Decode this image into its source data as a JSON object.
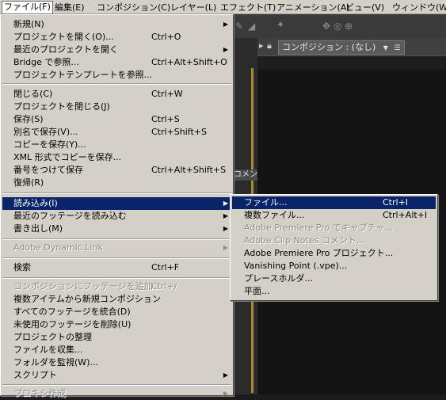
{
  "menubar": {
    "items": [
      {
        "label": "ファイル(F)"
      },
      {
        "label": "編集(E)"
      },
      {
        "label": "コンポジション(C)"
      },
      {
        "label": "レイヤー(L)"
      },
      {
        "label": "エフェクト(T)"
      },
      {
        "label": "アニメーション(A)"
      },
      {
        "label": "ビュー(V)"
      },
      {
        "label": "ウィンドウ(W)"
      }
    ]
  },
  "composition_panel": {
    "tab_label": "コンポジション : (なし)",
    "side_label": "コメン"
  },
  "file_menu": {
    "items": [
      {
        "label": "新規(N)",
        "shortcut": ""
      },
      {
        "label": "プロジェクトを開く(O)...",
        "shortcut": "Ctrl+O"
      },
      {
        "label": "最近のプロジェクトを開く",
        "shortcut": ""
      },
      {
        "label": "Bridge で参照...",
        "shortcut": "Ctrl+Alt+Shift+O"
      },
      {
        "label": "プロジェクトテンプレートを参照...",
        "shortcut": ""
      },
      {
        "label": "閉じる(C)",
        "shortcut": "Ctrl+W"
      },
      {
        "label": "プロジェクトを閉じる(J)",
        "shortcut": ""
      },
      {
        "label": "保存(S)",
        "shortcut": "Ctrl+S"
      },
      {
        "label": "別名で保存(V)...",
        "shortcut": "Ctrl+Shift+S"
      },
      {
        "label": "コピーを保存(Y)...",
        "shortcut": ""
      },
      {
        "label": "XML 形式でコピーを保存...",
        "shortcut": ""
      },
      {
        "label": "番号をつけて保存",
        "shortcut": "Ctrl+Alt+Shift+S"
      },
      {
        "label": "復帰(R)",
        "shortcut": ""
      },
      {
        "label": "読み込み(I)",
        "shortcut": ""
      },
      {
        "label": "最近のフッテージを読み込む",
        "shortcut": ""
      },
      {
        "label": "書き出し(M)",
        "shortcut": ""
      },
      {
        "label": "Adobe Dynamic Link",
        "shortcut": ""
      },
      {
        "label": "検索",
        "shortcut": "Ctrl+F"
      },
      {
        "label": "コンポジションにフッテージを追加",
        "shortcut": "Ctrl+/"
      },
      {
        "label": "複数アイテムから新規コンポジション",
        "shortcut": ""
      },
      {
        "label": "すべてのフッテージを統合(D)",
        "shortcut": ""
      },
      {
        "label": "未使用のフッテージを削除(U)",
        "shortcut": ""
      },
      {
        "label": "プロジェクトの整理",
        "shortcut": ""
      },
      {
        "label": "ファイルを収集...",
        "shortcut": ""
      },
      {
        "label": "フォルダを監視(W)...",
        "shortcut": ""
      },
      {
        "label": "スクリプト",
        "shortcut": ""
      },
      {
        "label": "プロキシ作成",
        "shortcut": ""
      }
    ]
  },
  "import_menu": {
    "items": [
      {
        "label": "ファイル...",
        "shortcut": "Ctrl+I"
      },
      {
        "label": "複数ファイル...",
        "shortcut": "Ctrl+Alt+I"
      },
      {
        "label": "Adobe Premiere Pro でキャプチャ...",
        "shortcut": ""
      },
      {
        "label": "Adobe Clip Notes コメント...",
        "shortcut": ""
      },
      {
        "label": "Adobe Premiere Pro プロジェクト...",
        "shortcut": ""
      },
      {
        "label": "Vanishing Point (.vpe)...",
        "shortcut": ""
      },
      {
        "label": "プレースホルダ...",
        "shortcut": ""
      },
      {
        "label": "平面...",
        "shortcut": ""
      }
    ]
  },
  "colors": {
    "menu_bg": "#d4d0c8",
    "highlight": "#0a246a",
    "disabled_text": "#8c8c8c",
    "app_bg": "#1c1c1c"
  }
}
